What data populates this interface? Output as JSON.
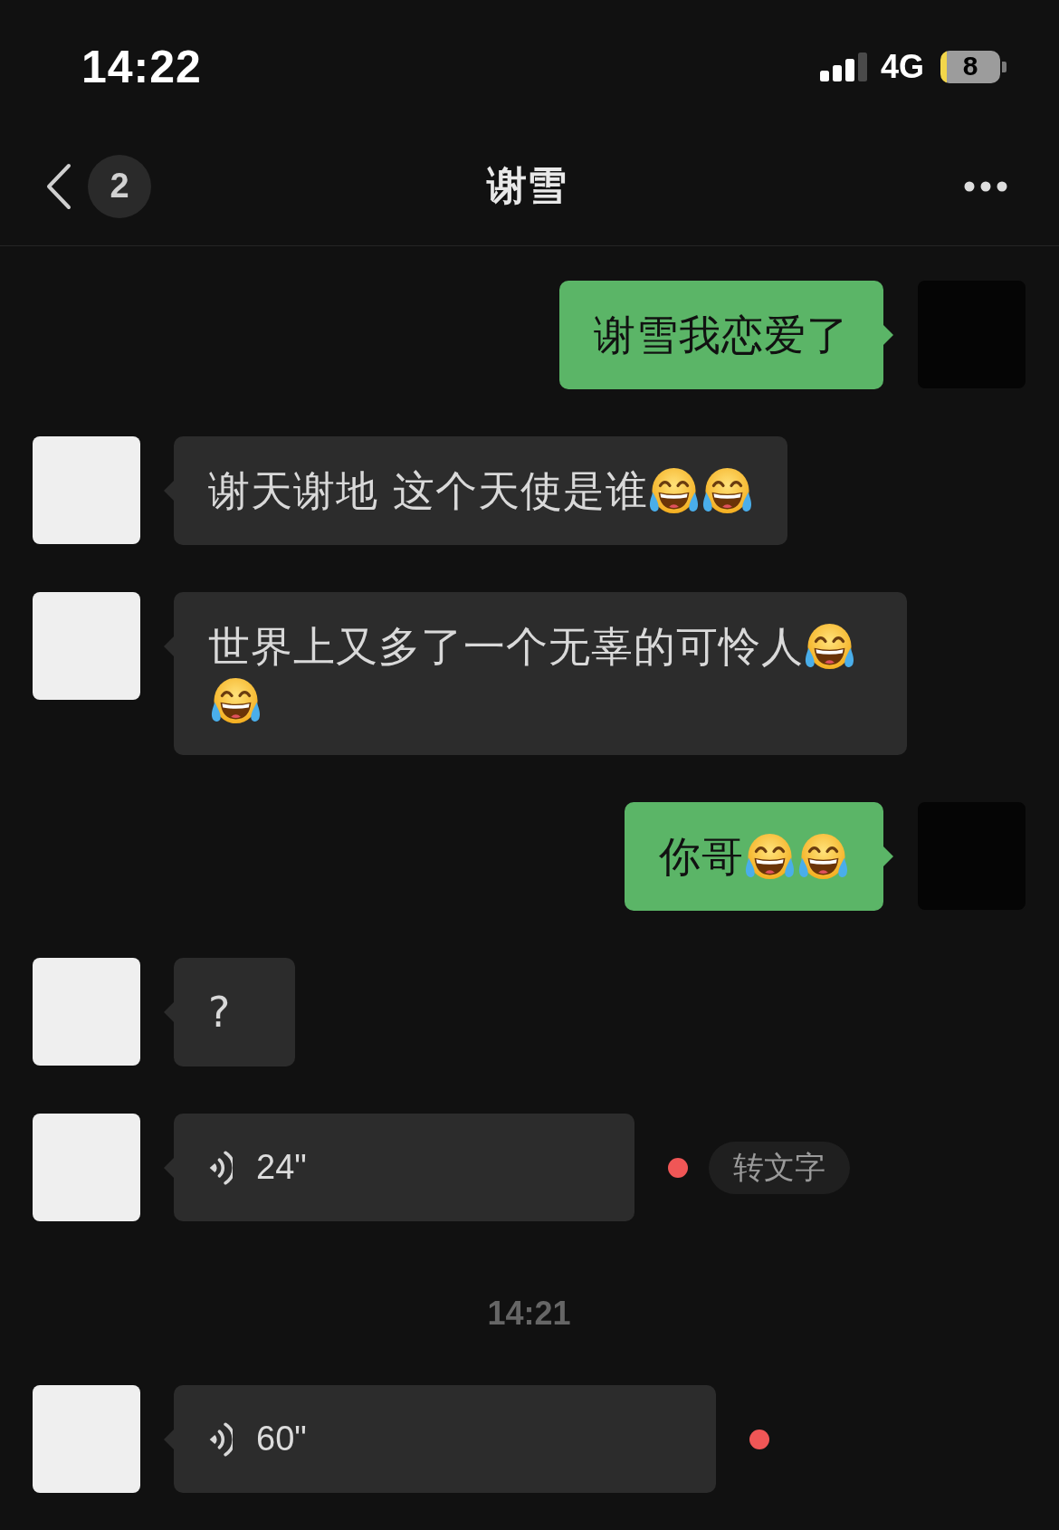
{
  "status_bar": {
    "time": "14:22",
    "network": "4G",
    "battery": "8"
  },
  "header": {
    "back_count": "2",
    "title": "谢雪"
  },
  "items": [
    {
      "kind": "text",
      "outgoing": true,
      "content": [
        {
          "kind": "text",
          "text": "谢雪我恋爱了"
        }
      ]
    },
    {
      "kind": "text",
      "outgoing": false,
      "content": [
        {
          "kind": "text",
          "text": "谢天谢地 这个天使是谁"
        },
        {
          "kind": "emoji"
        },
        {
          "kind": "emoji"
        }
      ]
    },
    {
      "kind": "text",
      "outgoing": false,
      "content": [
        {
          "kind": "text",
          "text": "世界上又多了一个无辜的可怜人"
        },
        {
          "kind": "emoji"
        },
        {
          "kind": "emoji"
        }
      ]
    },
    {
      "kind": "text",
      "outgoing": true,
      "content": [
        {
          "kind": "text",
          "text": "你哥"
        },
        {
          "kind": "emoji"
        },
        {
          "kind": "emoji"
        }
      ]
    },
    {
      "kind": "text",
      "outgoing": false,
      "content": [
        {
          "kind": "text",
          "text": "?"
        }
      ]
    },
    {
      "kind": "voice",
      "outgoing": false,
      "duration": "24\"",
      "unread": true,
      "action": "转文字"
    },
    {
      "kind": "timestamp",
      "text": "14:21"
    },
    {
      "kind": "voice",
      "outgoing": false,
      "duration": "60\"",
      "unread": true
    }
  ]
}
